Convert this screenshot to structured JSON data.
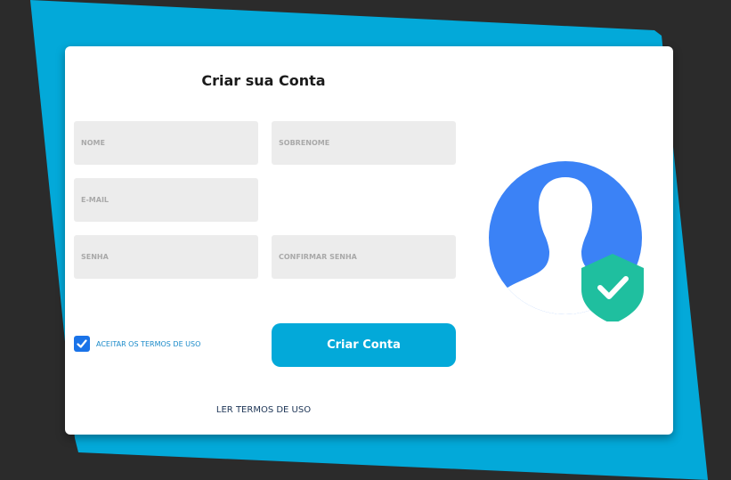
{
  "colors": {
    "background": "#2b2b2b",
    "accent_shape": "#03a9d9",
    "button": "#03a9d9",
    "checkbox": "#1a73e8",
    "avatar_circle": "#3b82f6",
    "shield": "#1fbf9f"
  },
  "form": {
    "title": "Criar sua Conta",
    "fields": {
      "nome": {
        "placeholder": "NOME",
        "value": ""
      },
      "sobrenome": {
        "placeholder": "SOBRENOME",
        "value": ""
      },
      "email": {
        "placeholder": "E-MAIL",
        "value": ""
      },
      "senha": {
        "placeholder": "SENHA",
        "value": ""
      },
      "confirmar_senha": {
        "placeholder": "CONFIRMAR SENHA",
        "value": ""
      }
    },
    "terms_checkbox": {
      "label": "ACEITAR OS TERMOS DE USO",
      "checked": true
    },
    "submit_label": "Criar Conta",
    "read_terms_link": "LER TERMOS DE USO"
  },
  "illustration": {
    "icon": "user-avatar-with-shield-check-icon"
  }
}
